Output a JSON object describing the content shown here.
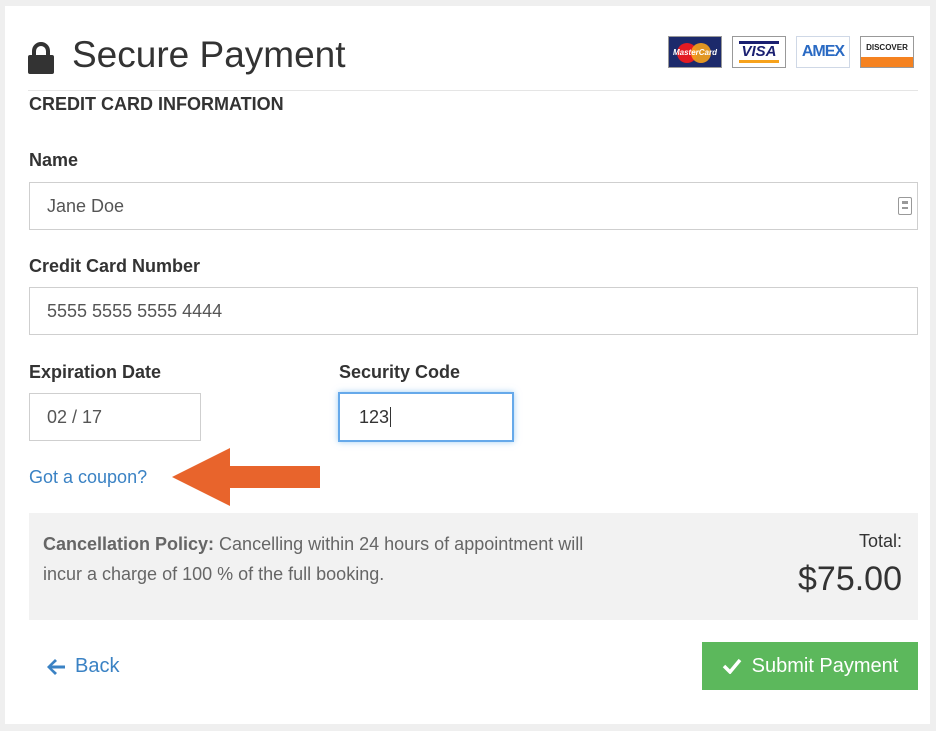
{
  "header": {
    "title": "Secure Payment",
    "cards": [
      {
        "name": "mastercard",
        "label": "MasterCard"
      },
      {
        "name": "visa",
        "label": "VISA"
      },
      {
        "name": "amex",
        "label": "AMEX"
      },
      {
        "name": "discover",
        "label": "DISCOVER"
      }
    ]
  },
  "form": {
    "section_title": "CREDIT CARD INFORMATION",
    "name_label": "Name",
    "name_value": "Jane Doe",
    "card_label": "Credit Card Number",
    "card_value": "5555 5555 5555 4444",
    "expiry_label": "Expiration Date",
    "expiry_value": "02 / 17",
    "cvc_label": "Security Code",
    "cvc_value": "123",
    "coupon_link": "Got a coupon?"
  },
  "policy": {
    "title": "Cancellation Policy:",
    "text": " Cancelling within 24 hours of appointment will incur a charge of 100 % of the full booking.",
    "total_label": "Total:",
    "total_amount": "$75.00"
  },
  "actions": {
    "back_label": "Back",
    "submit_label": "Submit Payment"
  },
  "colors": {
    "accent": "#3a82c4",
    "submit": "#5cb85c",
    "arrow": "#e8642c"
  }
}
